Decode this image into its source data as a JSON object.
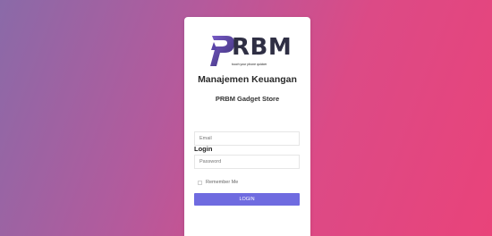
{
  "brand": {
    "logo_text": "RBM",
    "logo_tagline": "touch your phone quicker"
  },
  "header": {
    "title": "Manajemen Keuangan",
    "subtitle": "PRBM Gadget Store"
  },
  "login_form": {
    "section_label": "Login",
    "email_placeholder": "Email",
    "password_placeholder": "Password",
    "remember_label": "Remember Me",
    "remember_checked": false,
    "submit_label": "LOGIN"
  },
  "colors": {
    "background_start": "#8a6aa8",
    "background_end": "#e9437a",
    "button": "#6f6be0"
  }
}
